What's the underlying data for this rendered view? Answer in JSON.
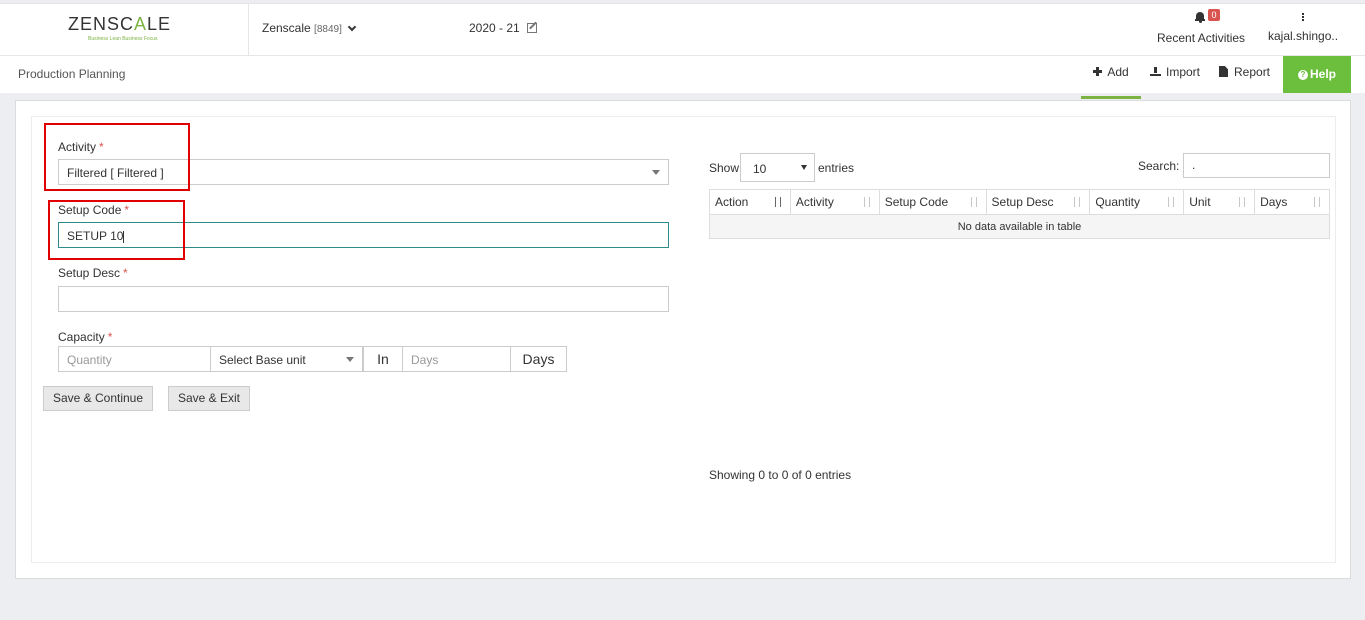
{
  "header": {
    "logo_text_1": "ZENSC",
    "logo_text_accent": "A",
    "logo_text_2": "LE",
    "logo_tagline": "Business Lean Business Focus",
    "company_name": "Zenscale",
    "company_code": "[8849]",
    "fiscal_year": "2020 - 21",
    "notifications_count": "0",
    "recent_activities_label": "Recent Activities",
    "user_name": "kajal.shingo.."
  },
  "subheader": {
    "page_title": "Production Planning",
    "add_label": "Add",
    "import_label": "Import",
    "report_label": "Report",
    "help_label": "Help"
  },
  "form": {
    "activity_label": "Activity",
    "activity_value": "Filtered [ Filtered ]",
    "setup_code_label": "Setup Code",
    "setup_code_value": "SETUP 10",
    "setup_desc_label": "Setup Desc",
    "setup_desc_value": "",
    "capacity_label": "Capacity",
    "quantity_placeholder": "Quantity",
    "base_unit_value": "Select Base unit",
    "in_label": "In",
    "days_placeholder": "Days",
    "days_label": "Days",
    "required_mark": "*",
    "save_continue_label": "Save & Continue",
    "save_exit_label": "Save & Exit"
  },
  "table": {
    "show_label": "Show",
    "page_length": "10",
    "entries_label": "entries",
    "search_label": "Search:",
    "search_value": ".",
    "columns": [
      "Action",
      "Activity",
      "Setup Code",
      "Setup Desc",
      "Quantity",
      "Unit",
      "Days"
    ],
    "empty_message": "No data available in table",
    "info": "Showing 0 to 0 of 0 entries"
  },
  "colors": {
    "accent_green": "#6cbf3c",
    "highlight_red": "#e00000",
    "required_red": "#d9534f"
  }
}
